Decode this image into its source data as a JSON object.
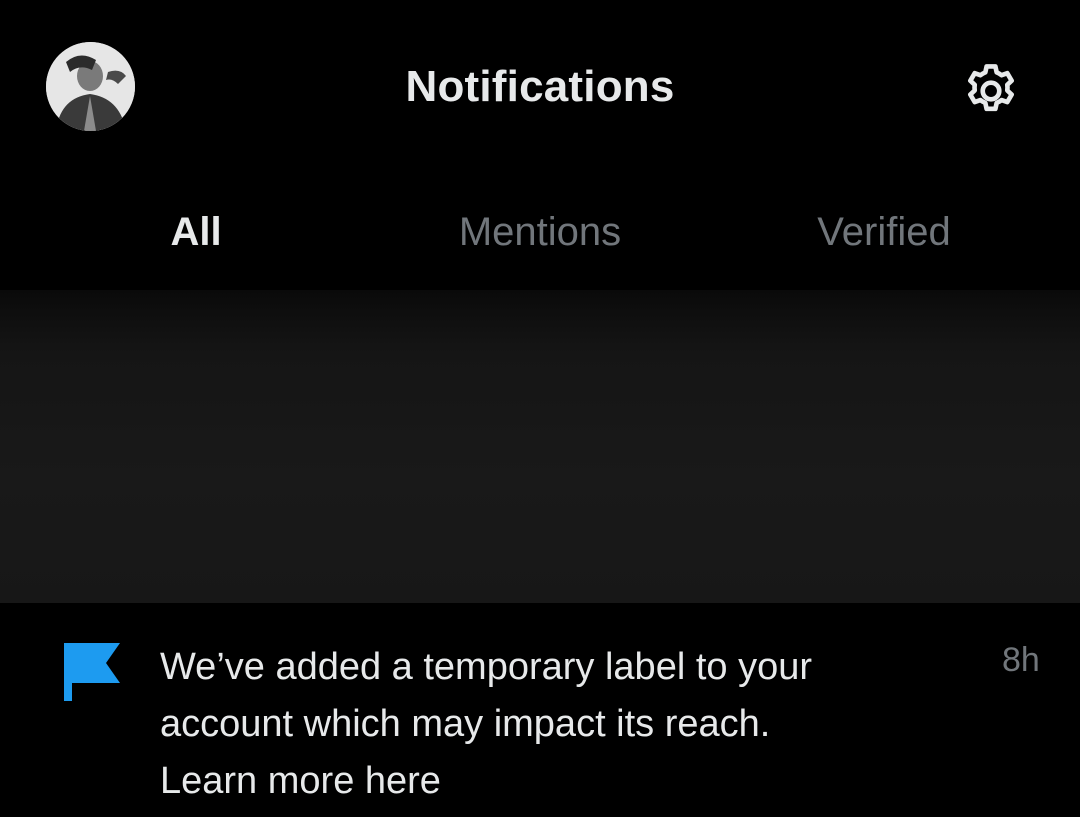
{
  "header": {
    "title": "Notifications",
    "avatar_icon": "user-avatar",
    "settings_icon": "gear-icon"
  },
  "tabs": [
    {
      "label": "All",
      "active": true
    },
    {
      "label": "Mentions",
      "active": false
    },
    {
      "label": "Verified",
      "active": false
    }
  ],
  "notification": {
    "icon": "flag-icon",
    "icon_color": "#1d9bf0",
    "line1": "We’ve added a temporary label to your",
    "line2": "account which may impact its reach.",
    "line3": "Learn more here",
    "time": "8h"
  },
  "colors": {
    "background": "#000000",
    "text_primary": "#e7e9ea",
    "text_secondary": "#71767b",
    "accent": "#1d9bf0"
  }
}
